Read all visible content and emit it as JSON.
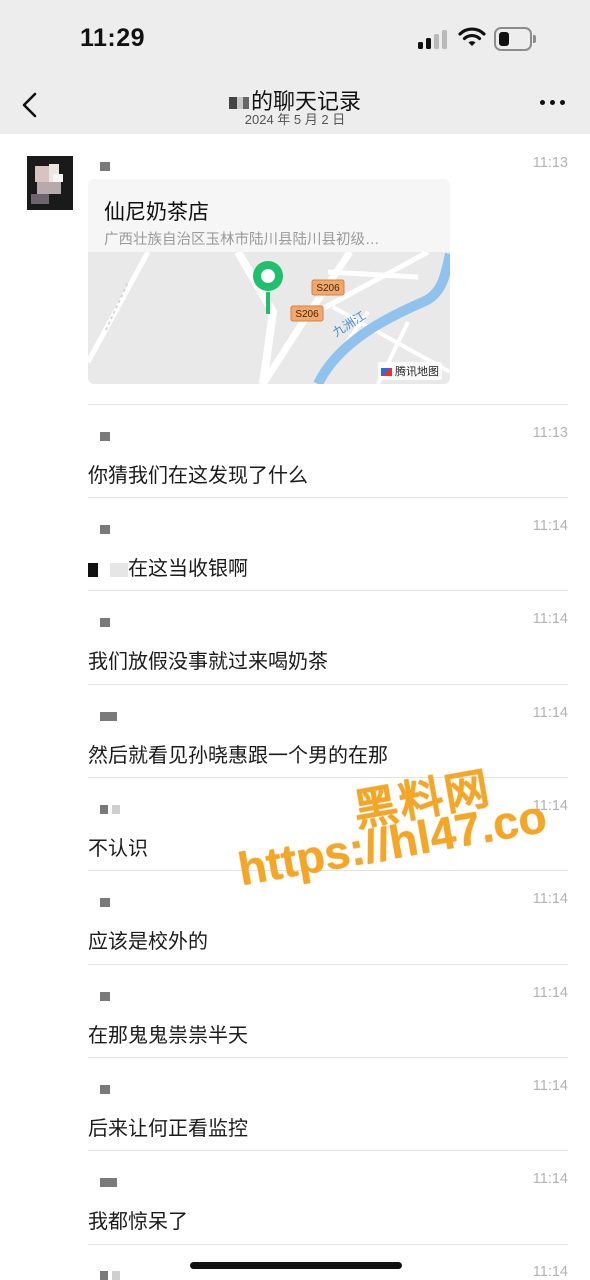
{
  "status_bar": {
    "time": "11:29"
  },
  "header": {
    "title": "的聊天记录",
    "date": "2024 年 5 月 2 日"
  },
  "location_card": {
    "time": "11:13",
    "name": "仙尼奶茶店",
    "address": "广西壮族自治区玉林市陆川县陆川县初级…",
    "map": {
      "road_labels": [
        "S206",
        "S206"
      ],
      "river_label": "九洲江",
      "provider": "腾讯地图"
    }
  },
  "messages": [
    {
      "time": "11:13",
      "text": "你猜我们在这发现了什么"
    },
    {
      "time": "11:14",
      "text": "在这当收银啊"
    },
    {
      "time": "11:14",
      "text": "我们放假没事就过来喝奶茶"
    },
    {
      "time": "11:14",
      "text": "然后就看见孙晓惠跟一个男的在那"
    },
    {
      "time": "11:14",
      "text": "不认识"
    },
    {
      "time": "11:14",
      "text": "应该是校外的"
    },
    {
      "time": "11:14",
      "text": "在那鬼鬼祟祟半天"
    },
    {
      "time": "11:14",
      "text": "后来让何正看监控"
    },
    {
      "time": "11:14",
      "text": "我都惊呆了"
    },
    {
      "time": "11:14",
      "text": ""
    }
  ],
  "watermark": {
    "title": "黑料网",
    "url": "https://hl47.co"
  },
  "colors": {
    "header_bg": "#ededed",
    "map_pin": "#1fc06b",
    "road_label": "#f3a76a",
    "river": "#8fc3ee",
    "watermark": "#f5a623"
  }
}
